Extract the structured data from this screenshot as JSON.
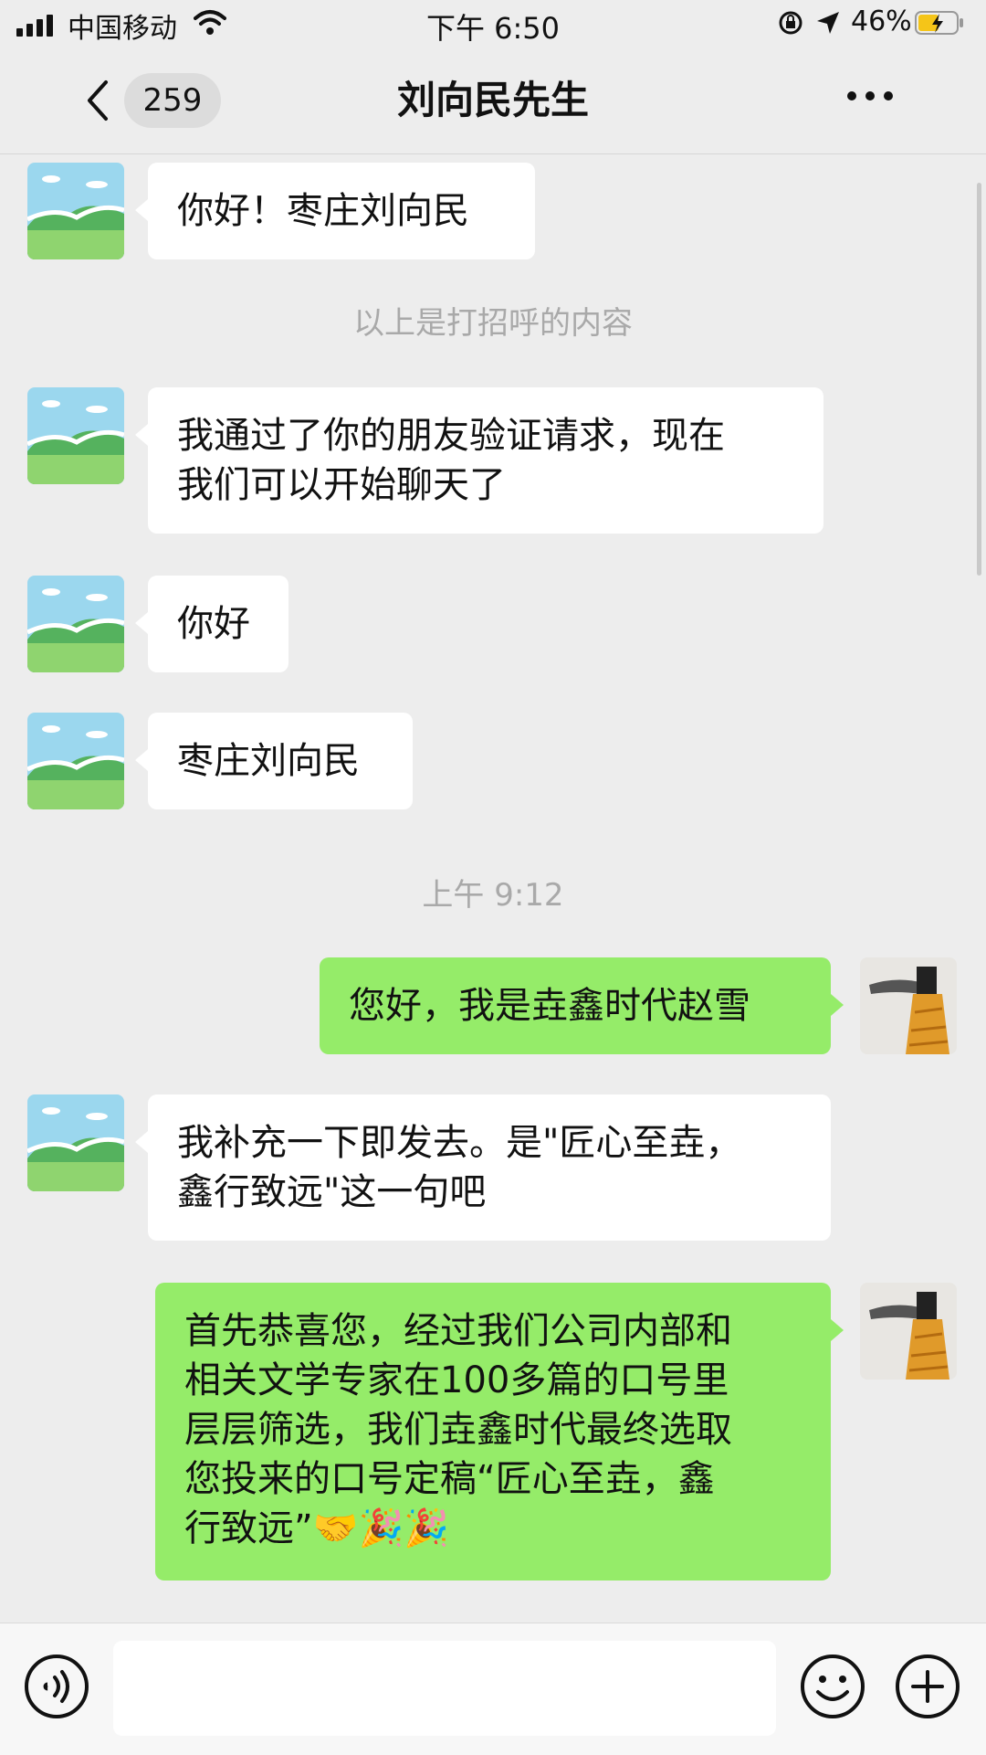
{
  "status_bar": {
    "carrier": "中国移动",
    "time": "下午 6:50",
    "battery_percent": "46%",
    "icons": [
      "signal-icon",
      "wifi-icon",
      "rotation-lock-icon",
      "location-icon",
      "battery-charging-icon"
    ]
  },
  "nav": {
    "back_badge": "259",
    "title": "刘向民先生",
    "icons": [
      "back-icon",
      "more-icon"
    ]
  },
  "messages": [
    {
      "side": "left",
      "text": "你好！枣庄刘向民"
    },
    {
      "type": "system",
      "text": "以上是打招呼的内容"
    },
    {
      "side": "left",
      "lines": [
        "我通过了你的朋友验证请求，现在",
        "我们可以开始聊天了"
      ]
    },
    {
      "side": "left",
      "text": "你好"
    },
    {
      "side": "left",
      "text": "枣庄刘向民"
    },
    {
      "type": "timestamp",
      "text": "上午 9:12"
    },
    {
      "side": "right",
      "text": "您好，我是垚鑫时代赵雪"
    },
    {
      "side": "left",
      "lines": [
        "我补充一下即发去。是\"匠心至垚，",
        "鑫行致远\"这一句吧"
      ]
    },
    {
      "side": "right",
      "lines": [
        "首先恭喜您，经过我们公司内部和",
        "相关文学专家在100多篇的口号里",
        "层层筛选，我们垚鑫时代最终选取",
        "您投来的口号定稿“匠心至垚，鑫",
        "行致远”🤝🎉🎉"
      ]
    }
  ],
  "input": {
    "value": "",
    "icons": [
      "voice-icon",
      "emoji-icon",
      "plus-icon"
    ]
  },
  "colors": {
    "background": "#ededed",
    "sent_bubble": "#95ec69",
    "received_bubble": "#ffffff",
    "system_text": "#a9a9a9"
  }
}
